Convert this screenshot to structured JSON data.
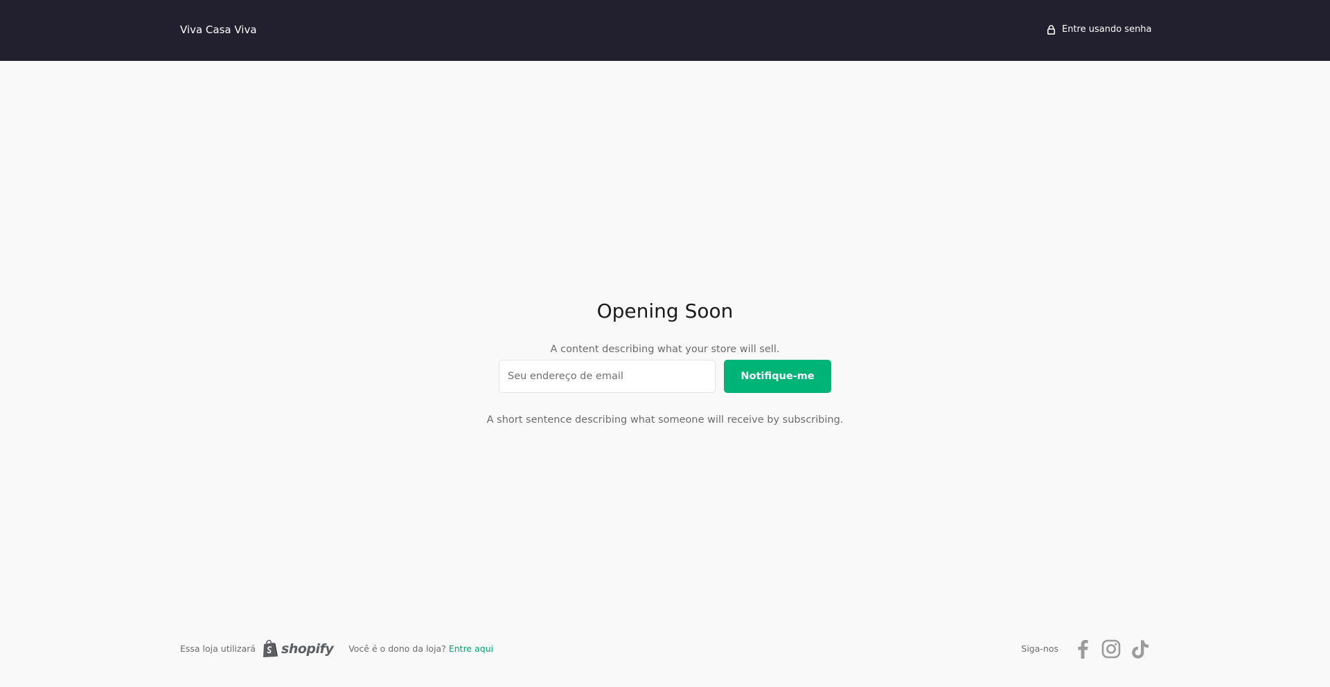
{
  "header": {
    "brand": "Viva Casa Viva",
    "password_link": "Entre usando senha",
    "password_icon": "lock-icon",
    "background_color": "#221f2e"
  },
  "hero": {
    "title": "Opening Soon",
    "description": "A content describing what your store will sell.",
    "email_placeholder": "Seu endereço de email",
    "email_value": "",
    "notify_label": "Notifique-me",
    "subtext": "A short sentence describing what someone will receive by subscribing.",
    "button_color": "#00b377"
  },
  "footer": {
    "powered_text": "Essa loja utilizará",
    "shopify_wordmark": "shopify",
    "owner_question": "Você é o dono da loja?",
    "owner_link": "Entre aqui",
    "link_color": "#00a36c",
    "follow_label": "Siga-nos",
    "social_icons": [
      "facebook-icon",
      "instagram-icon",
      "tiktok-icon"
    ]
  }
}
